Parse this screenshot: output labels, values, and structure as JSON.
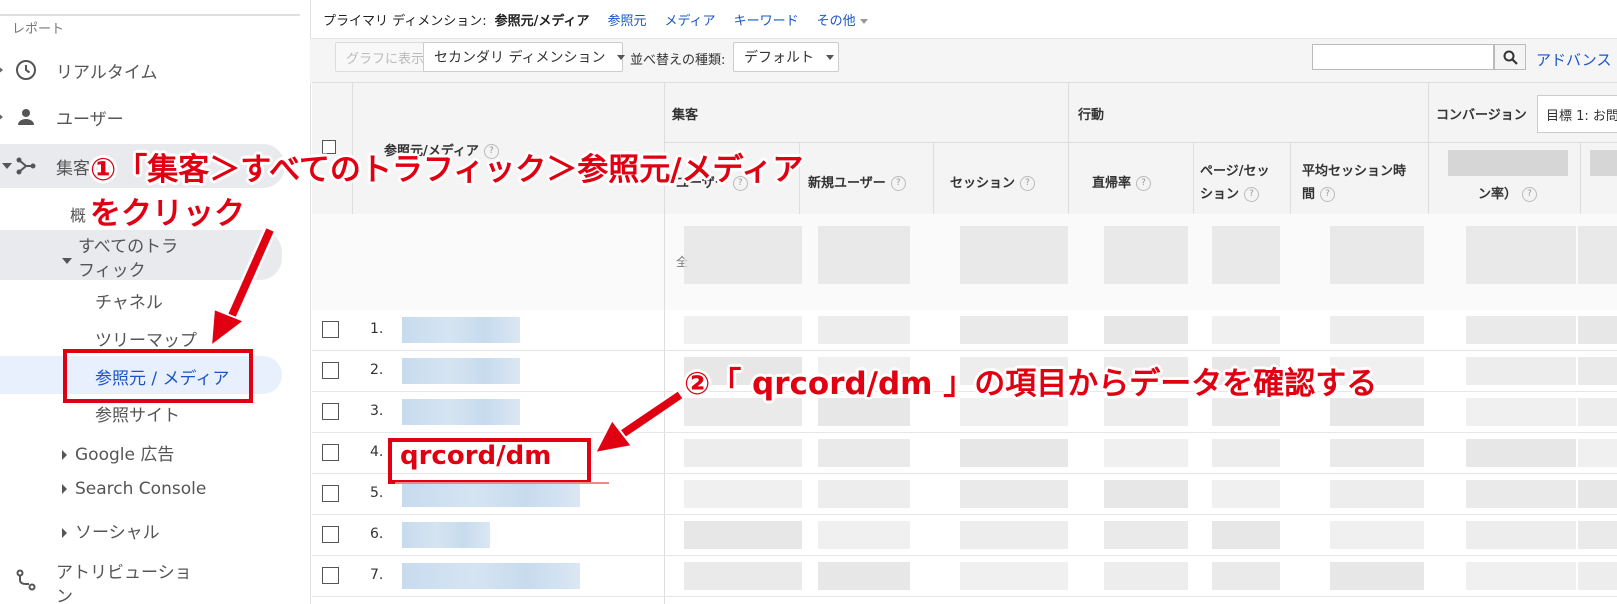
{
  "sidebar": {
    "header": "レポート",
    "items": [
      {
        "label": "リアルタイム",
        "icon": "clock-icon"
      },
      {
        "label": "ユーザー",
        "icon": "person-icon"
      },
      {
        "label": "集客",
        "icon": "acquisition-icon"
      }
    ],
    "sub_overview": "概",
    "all_traffic_line1": "すべてのトラ",
    "all_traffic_line2": "フィック",
    "children": [
      "チャネル",
      "ツリーマップ",
      "参照元 / メディア",
      "参照サイト"
    ],
    "groups": [
      "Google 広告",
      "Search Console",
      "ソーシャル"
    ],
    "attribution_line1": "アトリビューショ",
    "attribution_line2": "ン"
  },
  "toolbar": {
    "primary_label": "プライマリ ディメンション:",
    "primary_current": "参照元/メディア",
    "links": [
      "参照元",
      "メディア",
      "キーワード"
    ],
    "other": "その他",
    "graph_btn": "グラフに表示",
    "secondary_btn": "セカンダリ ディメンション",
    "sort_label": "並べ替えの種類:",
    "sort_value": "デフォルト",
    "advanced": "アドバンス"
  },
  "table": {
    "group_headers": [
      "集客",
      "行動",
      "コンバージョン"
    ],
    "goal_select": "目標 1: お問い",
    "dim_header": "参照元/メディア",
    "metric_headers": [
      "ユーザー",
      "新規ユーザー",
      "セッション",
      "直帰率"
    ],
    "pages_session_1": "ページ/セッ",
    "pages_session_2": "ション",
    "avg_time_1": "平均セッション時",
    "avg_time_2": "間",
    "conv_fragment": "ン率）",
    "total_fragment": "全",
    "rows": [
      {
        "num": "1."
      },
      {
        "num": "2."
      },
      {
        "num": "3."
      },
      {
        "num": "4.",
        "name": "qrcord/dm"
      },
      {
        "num": "5."
      },
      {
        "num": "6."
      },
      {
        "num": "7."
      }
    ]
  },
  "annotations": {
    "step1_line1": "①「集客＞すべてのトラフィック＞参照元/メディア",
    "step1_line2": "をクリック",
    "step2": "②「 qrcord/dm 」の項目からデータを確認する",
    "color": "#e00012"
  }
}
